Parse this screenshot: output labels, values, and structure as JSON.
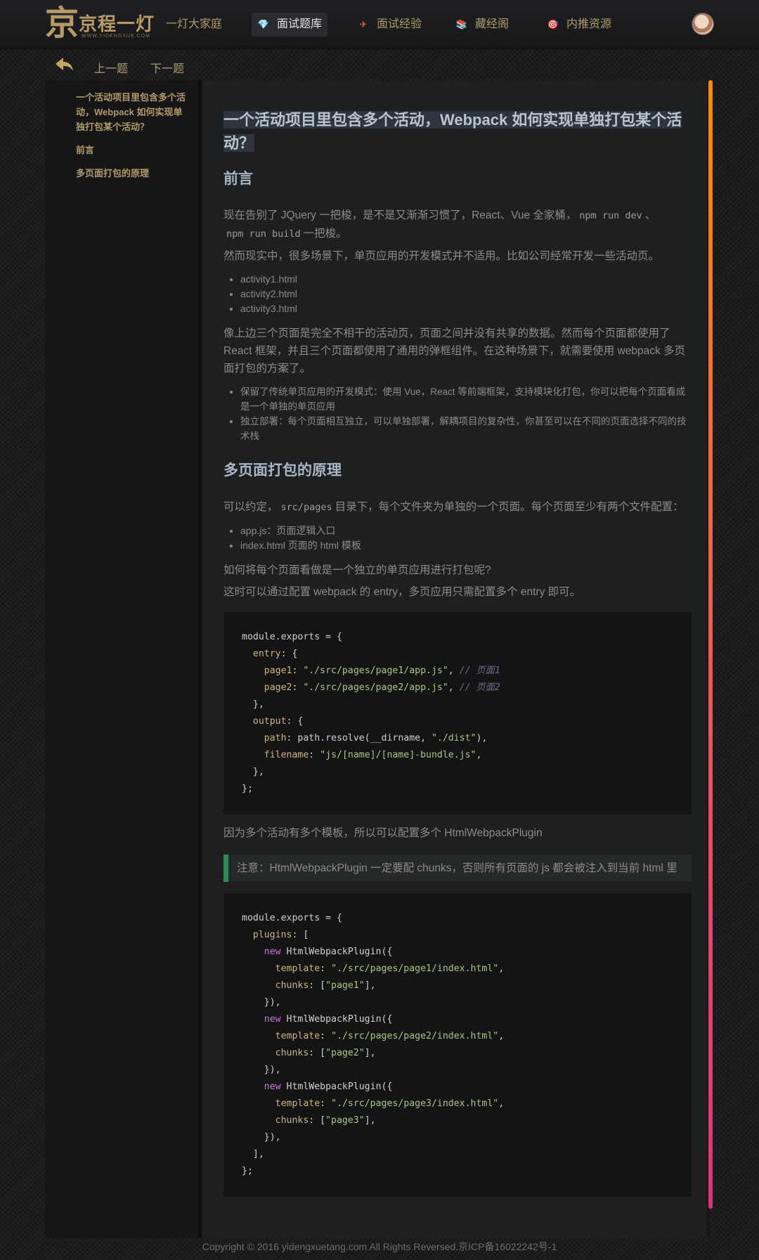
{
  "nav": {
    "logo_text": "京程一灯",
    "logo_sub": "WWW.YIDENGXUE.COM",
    "items": [
      {
        "label": "一灯大家庭",
        "icon": ""
      },
      {
        "label": "面试题库",
        "icon": "💎"
      },
      {
        "label": "面试经验",
        "icon": "✈"
      },
      {
        "label": "藏经阁",
        "icon": "📚"
      },
      {
        "label": "内推资源",
        "icon": "🎯"
      }
    ],
    "active_index": 1
  },
  "subbar": {
    "prev": "上一题",
    "next": "下一题"
  },
  "toc": [
    "一个活动项目里包含多个活动，Webpack 如何实现单独打包某个活动？",
    "前言",
    "多页面打包的原理"
  ],
  "article": {
    "title": "一个活动项目里包含多个活动，Webpack 如何实现单独打包某个活动？",
    "sec1": "前言",
    "p1a": "现在告别了 JQuery 一把梭，是不是又渐渐习惯了，React、Vue 全家桶，",
    "p1_code1": "npm run dev",
    "p1b": "、",
    "p1_code2": "npm run build",
    "p1c": "一把梭。",
    "p2": "然而现实中，很多场景下，单页应用的开发模式并不适用。比如公司经常开发一些活动页。",
    "list1": [
      "activity1.html",
      "activity2.html",
      "activity3.html"
    ],
    "p3": "像上边三个页面是完全不相干的活动页，页面之间并没有共享的数据。然而每个页面都使用了 React 框架，并且三个页面都使用了通用的弹框组件。在这种场景下，就需要使用 webpack 多页面打包的方案了。",
    "list2": [
      "保留了传统单页应用的开发模式：使用 Vue，React 等前端框架，支持模块化打包，你可以把每个页面看成是一个单独的单页应用",
      "独立部署：每个页面相互独立，可以单独部署，解耦项目的复杂性，你甚至可以在不同的页面选择不同的技术栈"
    ],
    "sec2": "多页面打包的原理",
    "p4a": "可以约定，",
    "p4_code": "src/pages",
    "p4b": "目录下，每个文件夹为单独的一个页面。每个页面至少有两个文件配置：",
    "list3": [
      "app.js：页面逻辑入口",
      "index.html 页面的 html 模板"
    ],
    "p5": "如何将每个页面看做是一个独立的单页应用进行打包呢?",
    "p6": "这时可以通过配置 webpack 的 entry，多页应用只需配置多个 entry 即可。",
    "code1": [
      "module.exports = {",
      "  entry: {",
      "    page1: \"./src/pages/page1/app.js\", // 页面1",
      "    page2: \"./src/pages/page2/app.js\", // 页面2",
      "  },",
      "  output: {",
      "    path: path.resolve(__dirname, \"./dist\"),",
      "    filename: \"js/[name]/[name]-bundle.js\",",
      "  },",
      "};"
    ],
    "p7": "因为多个活动有多个模板，所以可以配置多个 HtmlWebpackPlugin",
    "note": "注意：HtmlWebpackPlugin 一定要配 chunks，否则所有页面的 js 都会被注入到当前 html 里",
    "code2": [
      "module.exports = {",
      "  plugins: [",
      "    new HtmlWebpackPlugin({",
      "      template: \"./src/pages/page1/index.html\",",
      "      chunks: [\"page1\"],",
      "    }),",
      "    new HtmlWebpackPlugin({",
      "      template: \"./src/pages/page2/index.html\",",
      "      chunks: [\"page2\"],",
      "    }),",
      "    new HtmlWebpackPlugin({",
      "      template: \"./src/pages/page3/index.html\",",
      "      chunks: [\"page3\"],",
      "    }),",
      "  ],",
      "};"
    ]
  },
  "footer": "Copyright © 2016 yidengxuetang.com All Rights Reversed.京ICP备16022242号-1",
  "colors": {
    "accent": "#b09a6a",
    "scroll_top": "#ff8a00",
    "scroll_bottom": "#e0307a",
    "note_border": "#2e8b57"
  }
}
